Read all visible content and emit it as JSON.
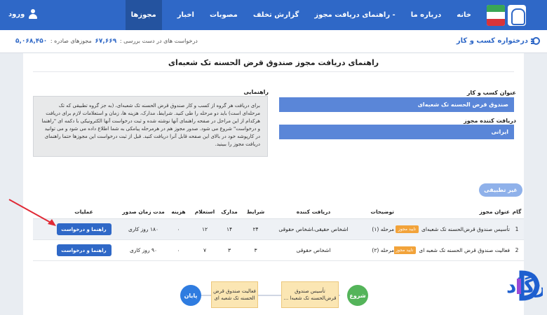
{
  "nav": {
    "items": [
      "خانه",
      "درباره ما",
      "راهنمای دریافت مجوز -",
      "گزارش تخلف",
      "مصوبات",
      "اخبار",
      "مجوزها"
    ],
    "login": "ورود"
  },
  "subbar": {
    "tree_label": "درختواره کسب و کار",
    "stats_prefix": "درخواست های در دست بررسی :",
    "pending": "۶۷,۶۶۹",
    "issued_label": "مجوزهای صادره :",
    "issued": "۵,۰۶۸,۴۵۰"
  },
  "page": {
    "title": "راهنمای دریافت مجوز صندوق قرض الحسنه تک شعبه‌ای",
    "business_label": "عنوان کسب و کار",
    "business_value": "صندوق قرض الحسنه تک شعبه‌ای",
    "issuer_label": "دریافت کننده مجوز",
    "issuer_value": "ایرانی",
    "guide_label": "راهنمایی",
    "guide_text": "برای دریافت هر گروه از کسب و کار صندوق قرض الحسنه تک شعبه‌ای، (به جز گروه تطبیقی که تک مرحله‌ای است) باید دو مرحله را طی کنید. شرایط، مدارک، هزینه ها، زمان و استعلامات لازم برای دریافت هرکدام از این مراحل در صفحه راهنمای آنها نوشته شده و ثبت درخواست آنها الکترونیکی با دکمه ای \"راهنما و درخواست\" شروع می شود. صدور مجوز هم در هرمرحله پیامکی به شما اطلاع داده می شود و می توانید در کارپوشه خود در بالای این صفحه قابل آنرا دریافت کنید. قبل از ثبت درخواست این مجوزها حتما راهنمای دریافت مجوز را ببینید.",
    "non_applicable": "غیر تطبیقی"
  },
  "table": {
    "headers": [
      "گام",
      "عنوان مجوز",
      "توضیحات",
      "دریافت کننده",
      "شرایط",
      "مدارک",
      "استعلام",
      "هزینه",
      "مدت زمان صدور",
      "عملیات"
    ],
    "rows": [
      {
        "step": "1",
        "name": "تأسیس صندوق قرض‌الحسنه تک شعبه‌ای",
        "badge": "تایید مجوز",
        "desc": "مرحله (۱)",
        "issuer": "اشخاص حقیقی،اشخاص حقوقی",
        "conditions": "۲۴",
        "docs": "۱۴",
        "inquiries": "۱۲",
        "cost": "۰",
        "time": "۱۸۰ روز کاری",
        "action": "راهنما و درخواست"
      },
      {
        "step": "2",
        "name": "فعالیت صندوق قرض الحسنه تک شعبه ای",
        "badge": "تایید مجوز",
        "desc": "مرحله (۲)",
        "issuer": "اشخاص حقوقی",
        "conditions": "۳",
        "docs": "۳",
        "inquiries": "۷",
        "cost": "۰",
        "time": "۹۰ روز کاری",
        "action": "راهنما و درخواست"
      }
    ]
  },
  "flow": {
    "start": "شروع",
    "step1": "تأسیس صندوق قرض‌الحسنه تک شعبه‌ا ...",
    "step2": "فعالیت صندوق قرض الحسنه تک شعبه ای",
    "end": "پایان"
  },
  "colors": {
    "primary": "#2f68c7",
    "field": "#5a86d8",
    "badge": "#f2a33a",
    "flow_start": "#54b45a",
    "flow_end": "#2f7ce0",
    "flow_box": "#fbe6b3",
    "arrow": "#e02a36",
    "watermark": "#1e5fcf"
  },
  "watermark": {
    "text": "پاسارگاد"
  }
}
